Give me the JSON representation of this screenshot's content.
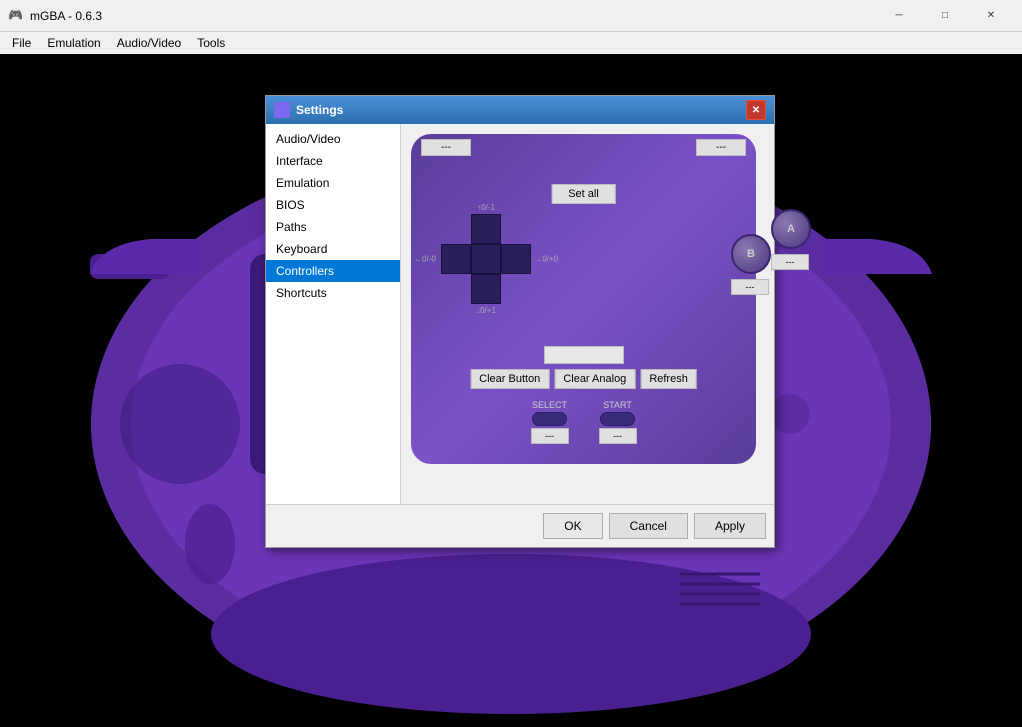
{
  "app": {
    "title": "mGBA - 0.6.3",
    "icon": "🎮"
  },
  "titlebar": {
    "minimize": "─",
    "maximize": "□",
    "close": "✕"
  },
  "menubar": {
    "items": [
      "File",
      "Emulation",
      "Audio/Video",
      "Tools"
    ]
  },
  "dialog": {
    "title": "Settings",
    "close_btn": "✕",
    "sidebar": {
      "items": [
        {
          "label": "Audio/Video",
          "id": "audio-video"
        },
        {
          "label": "Interface",
          "id": "interface"
        },
        {
          "label": "Emulation",
          "id": "emulation"
        },
        {
          "label": "BIOS",
          "id": "bios"
        },
        {
          "label": "Paths",
          "id": "paths"
        },
        {
          "label": "Keyboard",
          "id": "keyboard"
        },
        {
          "label": "Controllers",
          "id": "controllers",
          "selected": true
        },
        {
          "label": "Shortcuts",
          "id": "shortcuts"
        }
      ]
    },
    "controller": {
      "shoulder_left": "---",
      "shoulder_right": "---",
      "set_all": "Set all",
      "dpad_up": "↑0/-1",
      "dpad_down": "↓0/+1",
      "dpad_left": "←0/-0",
      "dpad_right": "→0/+0",
      "btn_b": "B",
      "btn_a": "A",
      "btn_a_field": "---",
      "btn_b_field": "---",
      "dropdown_value": "",
      "clear_button": "Clear Button",
      "clear_analog": "Clear Analog",
      "refresh": "Refresh",
      "select_label": "SELECT",
      "start_label": "START",
      "select_field": "---",
      "start_field": "---"
    },
    "footer": {
      "ok": "OK",
      "cancel": "Cancel",
      "apply": "Apply"
    }
  }
}
